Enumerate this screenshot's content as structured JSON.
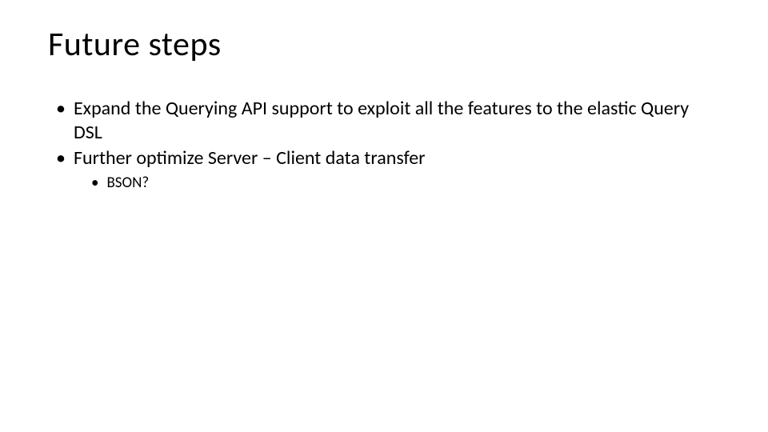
{
  "slide": {
    "title": "Future steps",
    "bullets": [
      {
        "text": "Expand the Querying API support to exploit all the features to the elastic Query DSL",
        "children": []
      },
      {
        "text": "Further optimize Server – Client data transfer",
        "children": [
          {
            "text": "BSON?"
          }
        ]
      }
    ]
  }
}
